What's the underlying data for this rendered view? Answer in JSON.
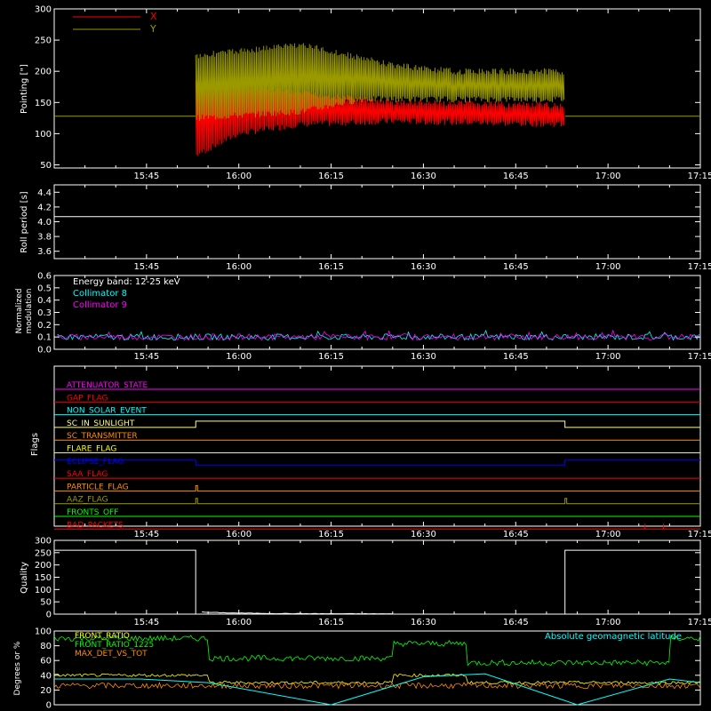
{
  "x_ticks": [
    "15:45",
    "16:00",
    "16:15",
    "16:30",
    "16:45",
    "17:00",
    "17:15"
  ],
  "colors": {
    "background": "#000000",
    "axis": "#ffffff",
    "red": "#ff0000",
    "olive": "#9a9a00",
    "cyan": "#00ffff",
    "magenta": "#ff00ff",
    "green": "#00ff00",
    "yellow": "#ffff00",
    "orange": "#ff8c00",
    "blue": "#0000ff",
    "sun": "#ffff80"
  },
  "chart_data": [
    {
      "type": "line",
      "ylabel": "Pointing [\"]",
      "ylim": [
        45,
        300
      ],
      "yticks": [
        "50",
        "100",
        "150",
        "200",
        "250",
        "300"
      ],
      "legend": [
        {
          "name": "X",
          "color": "#ff0000"
        },
        {
          "name": "Y",
          "color": "#9a9a00"
        }
      ],
      "x_range": [
        "15:30",
        "17:15"
      ],
      "series": [
        {
          "name": "X",
          "data_start": "15:53",
          "data_end": "16:53",
          "baseline": 128,
          "upper": [
            [
              "15:53",
              190
            ],
            [
              "16:10",
              170
            ],
            [
              "16:25",
              155
            ],
            [
              "16:53",
              150
            ]
          ],
          "lower": [
            [
              "15:53",
              60
            ],
            [
              "16:00",
              95
            ],
            [
              "16:10",
              110
            ],
            [
              "16:25",
              115
            ],
            [
              "16:53",
              110
            ]
          ]
        },
        {
          "name": "Y",
          "data_start": "15:53",
          "data_end": "16:53",
          "upper": [
            [
              "15:53",
              230
            ],
            [
              "16:10",
              248
            ],
            [
              "16:25",
              215
            ],
            [
              "16:35",
              205
            ],
            [
              "16:53",
              205
            ]
          ],
          "lower": [
            [
              "15:53",
              120
            ],
            [
              "16:10",
              130
            ],
            [
              "16:20",
              150
            ],
            [
              "16:53",
              150
            ]
          ]
        }
      ]
    },
    {
      "type": "line",
      "ylabel": "Roll period [s]",
      "ylim": [
        3.5,
        4.5
      ],
      "yticks": [
        "3.6",
        "3.8",
        "4.0",
        "4.2",
        "4.4"
      ],
      "value": 4.07
    },
    {
      "type": "line",
      "ylabel_lines": [
        "Normalized",
        "modulation"
      ],
      "ylim": [
        0,
        0.6
      ],
      "yticks": [
        "0.0",
        "0.1",
        "0.2",
        "0.3",
        "0.4",
        "0.5",
        "0.6"
      ],
      "legend_title": "Energy band: 12-25 keV",
      "series": [
        {
          "name": "Collimator 8",
          "color": "#00ffff",
          "mean": 0.1,
          "spread": 0.025
        },
        {
          "name": "Collimator 9",
          "color": "#ff00ff",
          "mean": 0.1,
          "spread": 0.025
        }
      ]
    },
    {
      "type": "table",
      "ylabel": "Flags",
      "flags": [
        {
          "name": "ATTENUATOR_STATE",
          "color": "#ff00ff"
        },
        {
          "name": "GAP_FLAG",
          "color": "#ff0000"
        },
        {
          "name": "NON_SOLAR_EVENT",
          "color": "#00ffff"
        },
        {
          "name": "SC_IN_SUNLIGHT",
          "color": "#ffff80"
        },
        {
          "name": "SC_TRANSMITTER",
          "color": "#ff8c00"
        },
        {
          "name": "FLARE_FLAG",
          "color": "#ffff00"
        },
        {
          "name": "ECLIPSE_FLAG",
          "color": "#0000ff"
        },
        {
          "name": "SAA_FLAG",
          "color": "#ff0000"
        },
        {
          "name": "PARTICLE_FLAG",
          "color": "#ff8c00"
        },
        {
          "name": "AAZ_FLAG",
          "color": "#9a9a00"
        },
        {
          "name": "FRONTS_OFF",
          "color": "#00ff00"
        },
        {
          "name": "BAD_PACKETS",
          "color": "#ff0000"
        }
      ]
    },
    {
      "type": "line",
      "ylabel": "Quality",
      "ylim": [
        0,
        300
      ],
      "yticks": [
        "0",
        "50",
        "100",
        "150",
        "200",
        "250",
        "300"
      ],
      "segments": [
        [
          "15:30",
          260
        ],
        [
          "15:53",
          260
        ],
        [
          "15:53",
          0
        ],
        [
          "16:53",
          0
        ],
        [
          "16:53",
          260
        ],
        [
          "17:15",
          260
        ]
      ]
    },
    {
      "type": "line",
      "ylabel": "Degrees or %",
      "ylim": [
        0,
        100
      ],
      "yticks": [
        "0",
        "20",
        "40",
        "60",
        "80",
        "100"
      ],
      "legend": [
        {
          "name": "FRONT_RATIO",
          "color": "#ffff00"
        },
        {
          "name": "FRONT_RATIO_1225",
          "color": "#00ff00"
        },
        {
          "name": "MAX_DET_VS_TOT",
          "color": "#ff8c00"
        }
      ],
      "annotation": "Absolute geomagnetic latitude",
      "annotation_color": "#00ffff"
    }
  ]
}
